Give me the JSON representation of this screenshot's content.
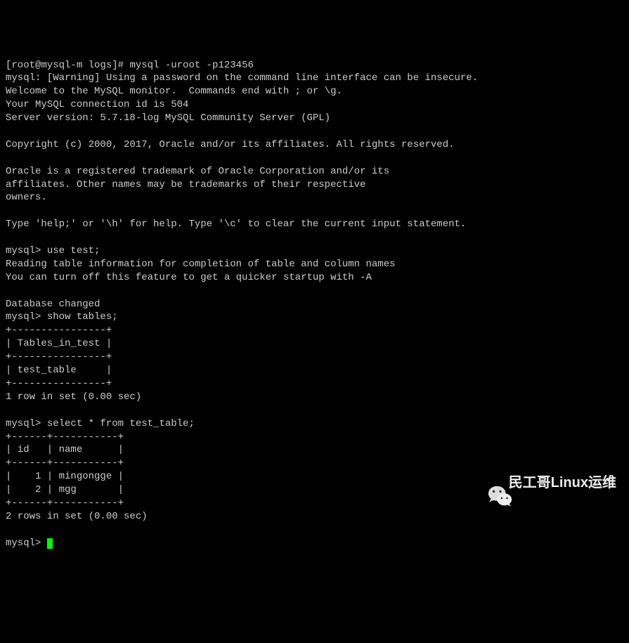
{
  "terminal": {
    "line1_prompt": "[root@mysql-m logs]# ",
    "line1_cmd": "mysql -uroot -p123456",
    "line2": "mysql: [Warning] Using a password on the command line interface can be insecure.",
    "line3": "Welcome to the MySQL monitor.  Commands end with ; or \\g.",
    "line4": "Your MySQL connection id is 504",
    "line5": "Server version: 5.7.18-log MySQL Community Server (GPL)",
    "blank1": "",
    "line6": "Copyright (c) 2000, 2017, Oracle and/or its affiliates. All rights reserved.",
    "blank2": "",
    "line7": "Oracle is a registered trademark of Oracle Corporation and/or its",
    "line8": "affiliates. Other names may be trademarks of their respective",
    "line9": "owners.",
    "blank3": "",
    "line10": "Type 'help;' or '\\h' for help. Type '\\c' to clear the current input statement.",
    "blank4": "",
    "line11_prompt": "mysql> ",
    "line11_cmd": "use test;",
    "line12": "Reading table information for completion of table and column names",
    "line13": "You can turn off this feature to get a quicker startup with -A",
    "blank5": "",
    "line14": "Database changed",
    "line15_prompt": "mysql> ",
    "line15_cmd": "show tables;",
    "line16": "+----------------+",
    "line17": "| Tables_in_test |",
    "line18": "+----------------+",
    "line19": "| test_table     |",
    "line20": "+----------------+",
    "line21": "1 row in set (0.00 sec)",
    "blank6": "",
    "line22_prompt": "mysql> ",
    "line22_cmd": "select * from test_table;",
    "line23": "+------+-----------+",
    "line24": "| id   | name      |",
    "line25": "+------+-----------+",
    "line26": "|    1 | mingongge |",
    "line27": "|    2 | mgg       |",
    "line28": "+------+-----------+",
    "line29": "2 rows in set (0.00 sec)",
    "blank7": "",
    "line30_prompt": "mysql> "
  },
  "watermark": {
    "text": "民工哥Linux运维"
  }
}
